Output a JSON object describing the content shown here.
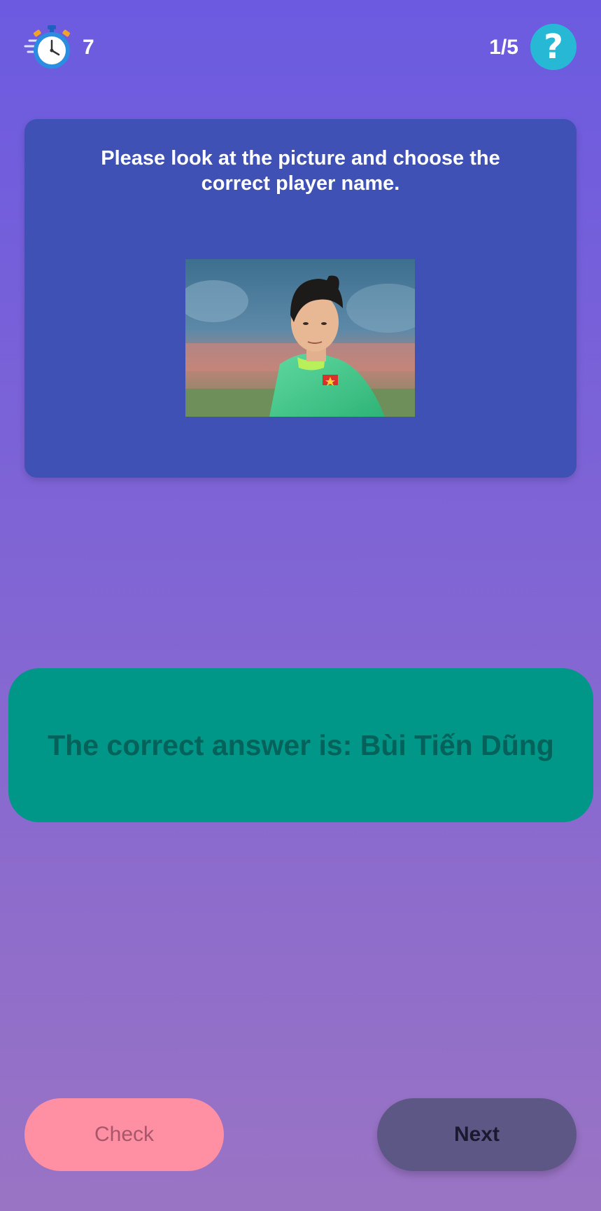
{
  "header": {
    "timer_icon": "stopwatch-icon",
    "timer_value": "7",
    "progress": "1/5",
    "help_icon": "question-mark-icon",
    "help_label": "?"
  },
  "question": {
    "text": "Please look at the picture and choose the correct player name.",
    "image": "player-photo"
  },
  "answer": {
    "text": "The correct answer is: Bùi Tiến Dũng"
  },
  "actions": {
    "check_label": "Check",
    "next_label": "Next"
  },
  "colors": {
    "background_top": "#6c5be0",
    "background_bottom": "#9a74c4",
    "card": "#3f51b5",
    "answer_bg": "#009688",
    "answer_text": "#05625a",
    "help": "#27b8d6",
    "check_bg": "#ff8fa3",
    "next_bg": "#5d5785"
  }
}
